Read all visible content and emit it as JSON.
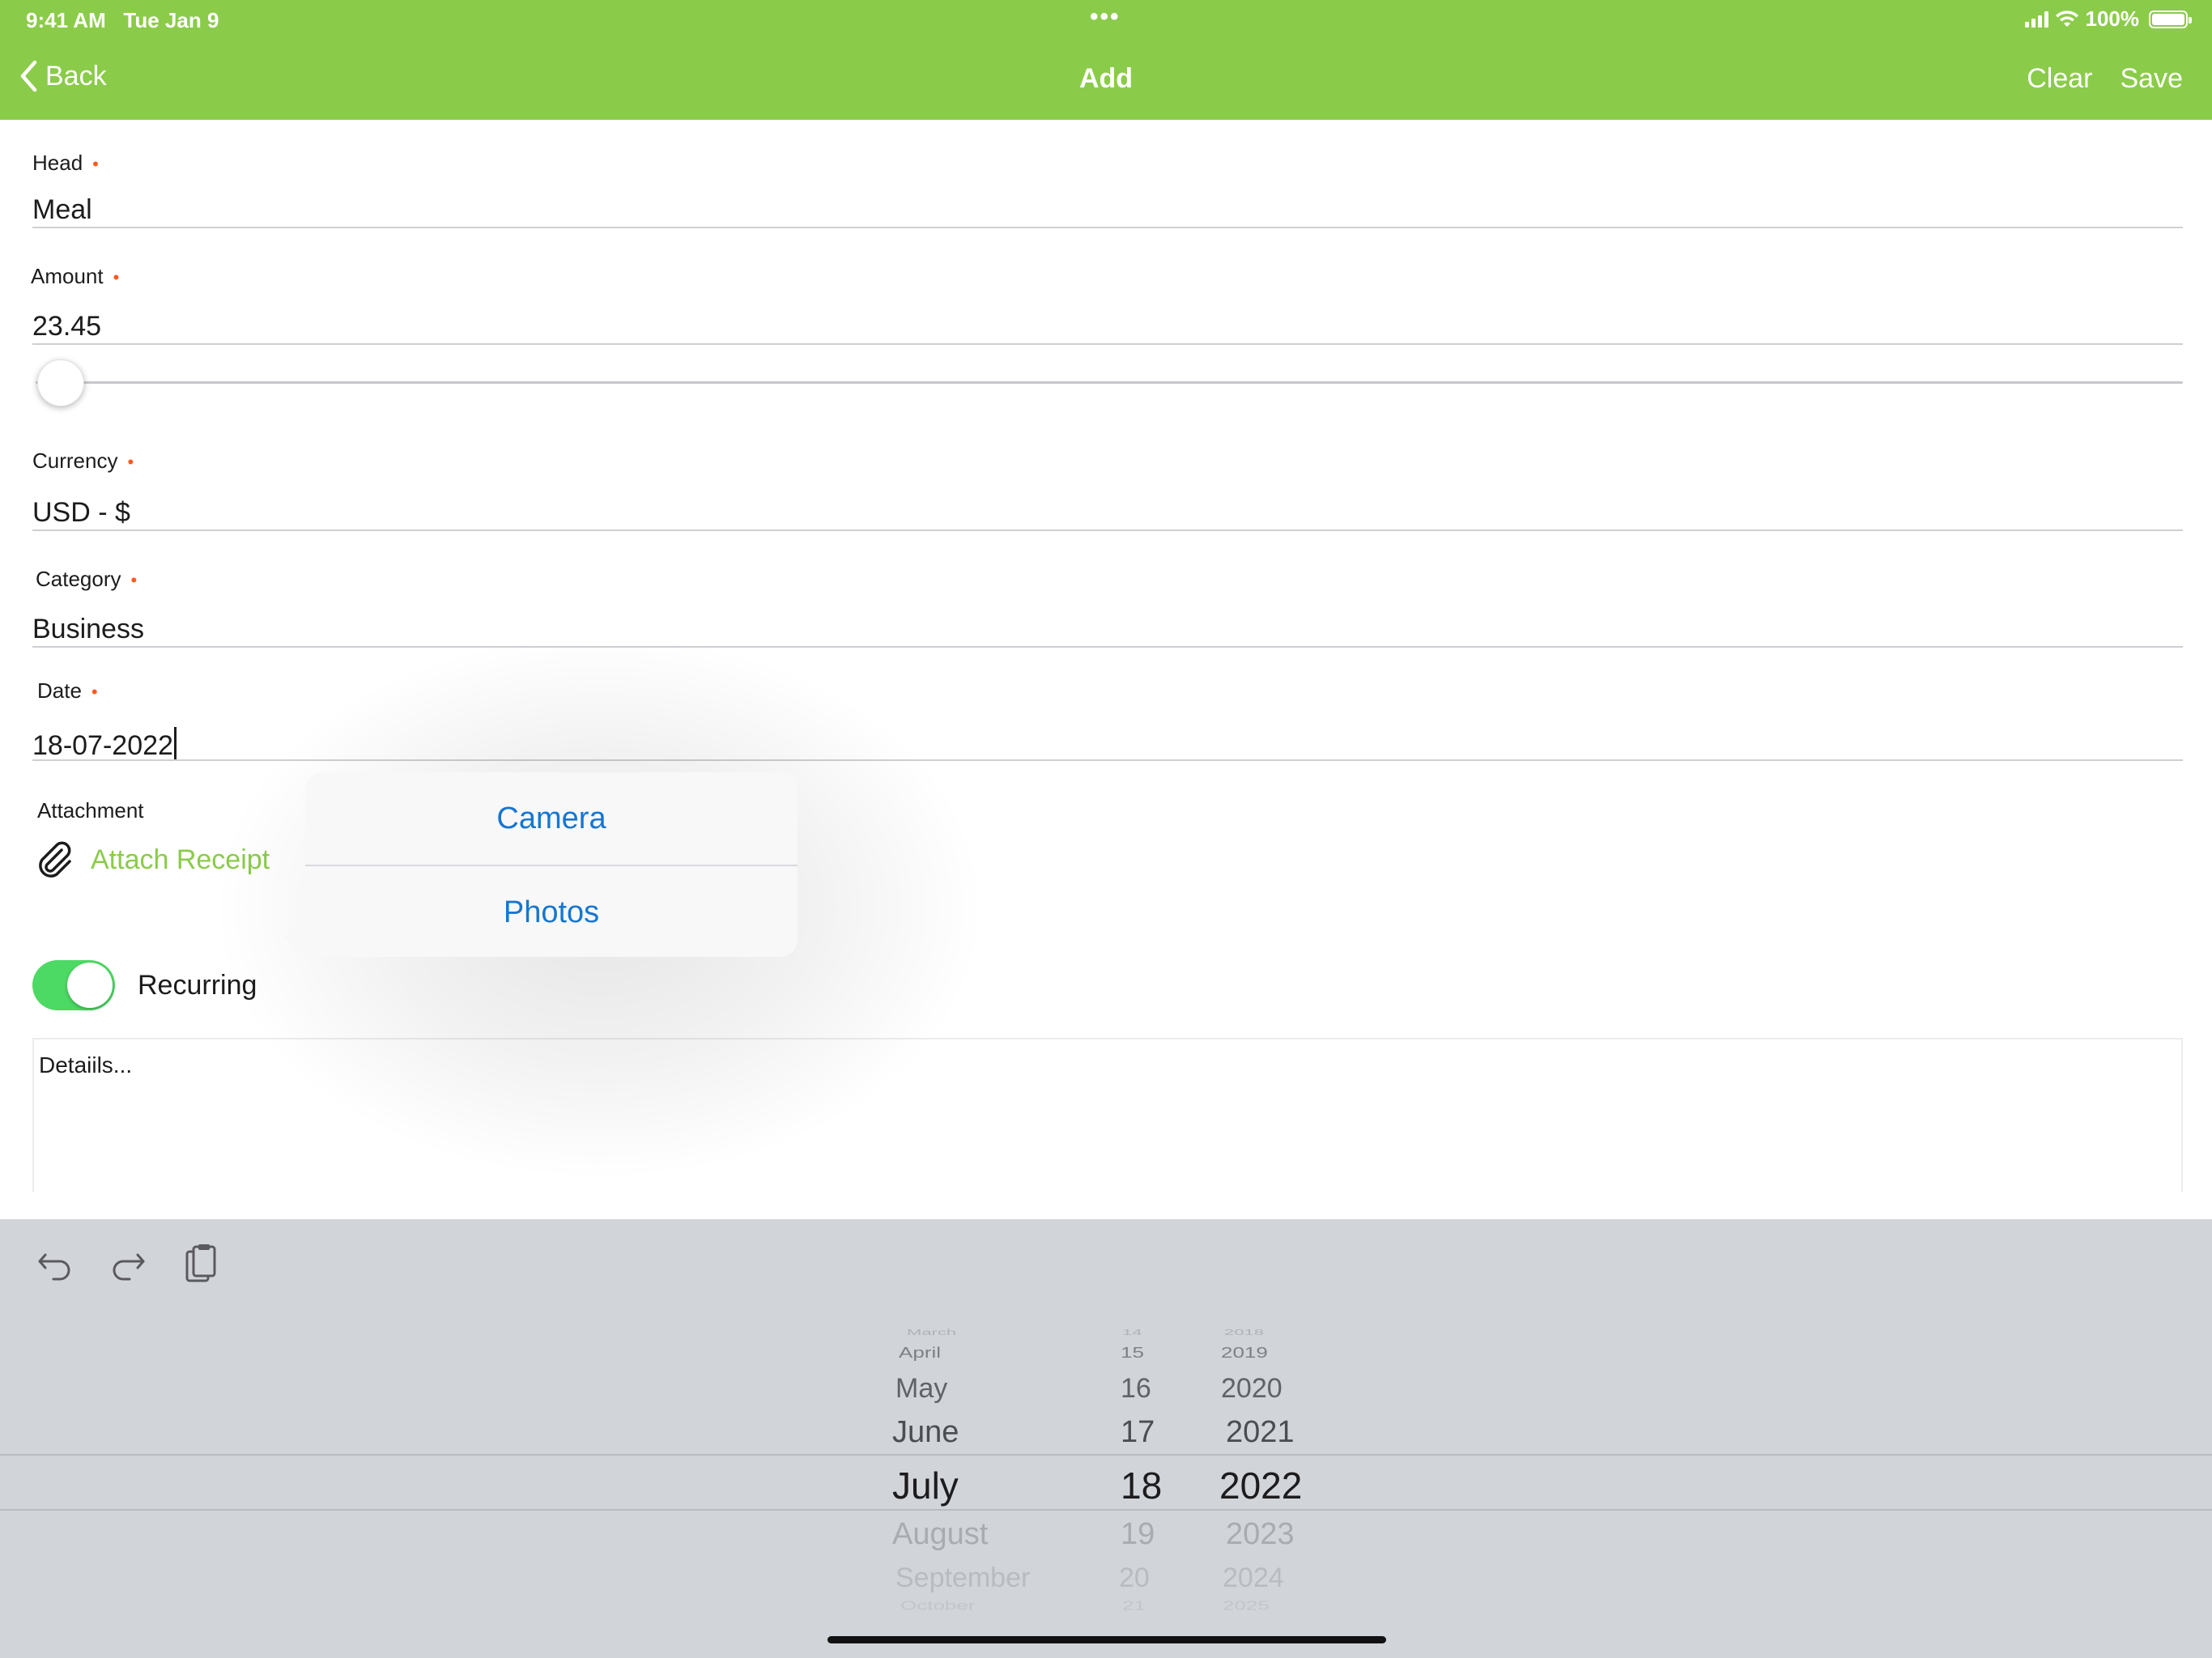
{
  "status_bar": {
    "time": "9:41 AM",
    "date": "Tue Jan 9",
    "dots": "•••",
    "battery": "100%"
  },
  "nav": {
    "back_label": "Back",
    "title": "Add",
    "clear_label": "Clear",
    "save_label": "Save"
  },
  "form": {
    "head": {
      "label": "Head",
      "required": "•",
      "value": "Meal"
    },
    "amount": {
      "label": "Amount",
      "required": "•",
      "value": "23.45",
      "slider_level": 0.0
    },
    "currency": {
      "label": "Currency",
      "required": "•",
      "value": "USD - $"
    },
    "category": {
      "label": "Category",
      "required": "•",
      "value": "Business"
    },
    "date": {
      "label": "Date",
      "required": "•",
      "value": "18-07-2022"
    },
    "attachment": {
      "label": "Attachment",
      "action": "Attach Receipt"
    },
    "recurring": {
      "label": "Recurring",
      "on": true
    },
    "details": {
      "placeholder": "Detaiils..."
    }
  },
  "popover": {
    "items": [
      "Camera",
      "Photos"
    ]
  },
  "date_picker": {
    "months": [
      "March",
      "April",
      "May",
      "June",
      "July",
      "August",
      "September",
      "October"
    ],
    "days": [
      "14",
      "15",
      "16",
      "17",
      "18",
      "19",
      "20",
      "21"
    ],
    "years": [
      "2018",
      "2019",
      "2020",
      "2021",
      "2022",
      "2023",
      "2024",
      "2025"
    ],
    "selected": {
      "month": "July",
      "day": "18",
      "year": "2022"
    }
  },
  "colors": {
    "accent": "#8bcb4a",
    "toggle_on": "#4cd964",
    "link": "#1776cf",
    "required": "#ff5a1f"
  }
}
